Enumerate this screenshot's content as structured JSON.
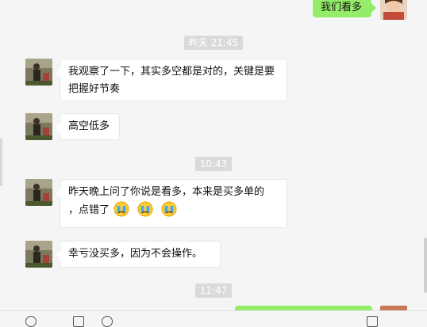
{
  "messages": [
    {
      "sender": "me",
      "text": "我们看多"
    },
    {
      "timestamp": "昨天 21:45"
    },
    {
      "sender": "other",
      "text": "我观察了一下，其实多空都是对的，关键是要把握好节奏"
    },
    {
      "sender": "other",
      "text": "高空低多"
    },
    {
      "timestamp": "10:43"
    },
    {
      "sender": "other",
      "text_line1": "昨天晚上问了你说是看多，本来是买多单的",
      "text_line2": "，点错了",
      "emojis": [
        "crying-emoji",
        "crying-emoji",
        "crying-emoji"
      ]
    },
    {
      "sender": "other",
      "text": "幸亏没买多，因为不会操作。"
    },
    {
      "timestamp": "11:47"
    }
  ],
  "colors": {
    "my_bubble": "#95ec69",
    "other_bubble": "#ffffff",
    "chat_background": "#f5f5f5",
    "timestamp_bg": "#dadada"
  }
}
